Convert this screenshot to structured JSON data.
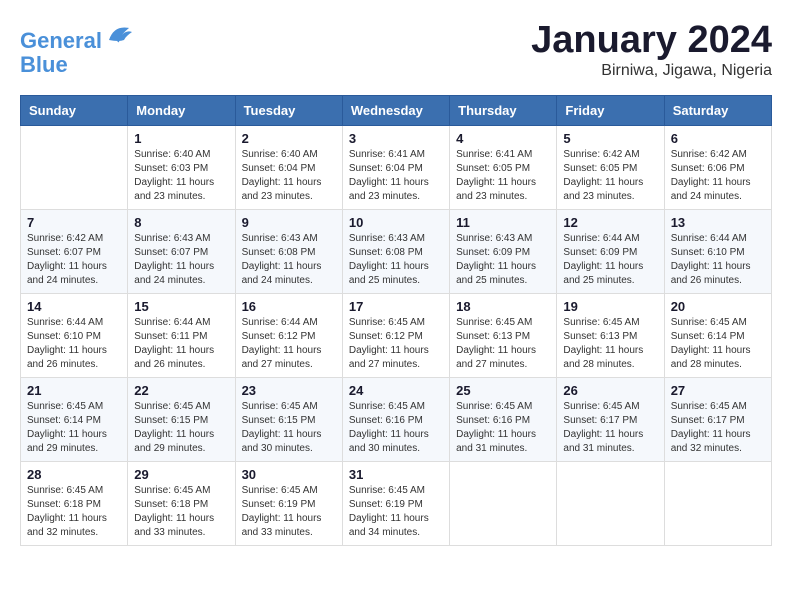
{
  "logo": {
    "line1": "General",
    "line2": "Blue"
  },
  "title": "January 2024",
  "subtitle": "Birniwa, Jigawa, Nigeria",
  "days_of_week": [
    "Sunday",
    "Monday",
    "Tuesday",
    "Wednesday",
    "Thursday",
    "Friday",
    "Saturday"
  ],
  "weeks": [
    [
      {
        "day": "",
        "info": ""
      },
      {
        "day": "1",
        "info": "Sunrise: 6:40 AM\nSunset: 6:03 PM\nDaylight: 11 hours\nand 23 minutes."
      },
      {
        "day": "2",
        "info": "Sunrise: 6:40 AM\nSunset: 6:04 PM\nDaylight: 11 hours\nand 23 minutes."
      },
      {
        "day": "3",
        "info": "Sunrise: 6:41 AM\nSunset: 6:04 PM\nDaylight: 11 hours\nand 23 minutes."
      },
      {
        "day": "4",
        "info": "Sunrise: 6:41 AM\nSunset: 6:05 PM\nDaylight: 11 hours\nand 23 minutes."
      },
      {
        "day": "5",
        "info": "Sunrise: 6:42 AM\nSunset: 6:05 PM\nDaylight: 11 hours\nand 23 minutes."
      },
      {
        "day": "6",
        "info": "Sunrise: 6:42 AM\nSunset: 6:06 PM\nDaylight: 11 hours\nand 24 minutes."
      }
    ],
    [
      {
        "day": "7",
        "info": "Sunrise: 6:42 AM\nSunset: 6:07 PM\nDaylight: 11 hours\nand 24 minutes."
      },
      {
        "day": "8",
        "info": "Sunrise: 6:43 AM\nSunset: 6:07 PM\nDaylight: 11 hours\nand 24 minutes."
      },
      {
        "day": "9",
        "info": "Sunrise: 6:43 AM\nSunset: 6:08 PM\nDaylight: 11 hours\nand 24 minutes."
      },
      {
        "day": "10",
        "info": "Sunrise: 6:43 AM\nSunset: 6:08 PM\nDaylight: 11 hours\nand 25 minutes."
      },
      {
        "day": "11",
        "info": "Sunrise: 6:43 AM\nSunset: 6:09 PM\nDaylight: 11 hours\nand 25 minutes."
      },
      {
        "day": "12",
        "info": "Sunrise: 6:44 AM\nSunset: 6:09 PM\nDaylight: 11 hours\nand 25 minutes."
      },
      {
        "day": "13",
        "info": "Sunrise: 6:44 AM\nSunset: 6:10 PM\nDaylight: 11 hours\nand 26 minutes."
      }
    ],
    [
      {
        "day": "14",
        "info": "Sunrise: 6:44 AM\nSunset: 6:10 PM\nDaylight: 11 hours\nand 26 minutes."
      },
      {
        "day": "15",
        "info": "Sunrise: 6:44 AM\nSunset: 6:11 PM\nDaylight: 11 hours\nand 26 minutes."
      },
      {
        "day": "16",
        "info": "Sunrise: 6:44 AM\nSunset: 6:12 PM\nDaylight: 11 hours\nand 27 minutes."
      },
      {
        "day": "17",
        "info": "Sunrise: 6:45 AM\nSunset: 6:12 PM\nDaylight: 11 hours\nand 27 minutes."
      },
      {
        "day": "18",
        "info": "Sunrise: 6:45 AM\nSunset: 6:13 PM\nDaylight: 11 hours\nand 27 minutes."
      },
      {
        "day": "19",
        "info": "Sunrise: 6:45 AM\nSunset: 6:13 PM\nDaylight: 11 hours\nand 28 minutes."
      },
      {
        "day": "20",
        "info": "Sunrise: 6:45 AM\nSunset: 6:14 PM\nDaylight: 11 hours\nand 28 minutes."
      }
    ],
    [
      {
        "day": "21",
        "info": "Sunrise: 6:45 AM\nSunset: 6:14 PM\nDaylight: 11 hours\nand 29 minutes."
      },
      {
        "day": "22",
        "info": "Sunrise: 6:45 AM\nSunset: 6:15 PM\nDaylight: 11 hours\nand 29 minutes."
      },
      {
        "day": "23",
        "info": "Sunrise: 6:45 AM\nSunset: 6:15 PM\nDaylight: 11 hours\nand 30 minutes."
      },
      {
        "day": "24",
        "info": "Sunrise: 6:45 AM\nSunset: 6:16 PM\nDaylight: 11 hours\nand 30 minutes."
      },
      {
        "day": "25",
        "info": "Sunrise: 6:45 AM\nSunset: 6:16 PM\nDaylight: 11 hours\nand 31 minutes."
      },
      {
        "day": "26",
        "info": "Sunrise: 6:45 AM\nSunset: 6:17 PM\nDaylight: 11 hours\nand 31 minutes."
      },
      {
        "day": "27",
        "info": "Sunrise: 6:45 AM\nSunset: 6:17 PM\nDaylight: 11 hours\nand 32 minutes."
      }
    ],
    [
      {
        "day": "28",
        "info": "Sunrise: 6:45 AM\nSunset: 6:18 PM\nDaylight: 11 hours\nand 32 minutes."
      },
      {
        "day": "29",
        "info": "Sunrise: 6:45 AM\nSunset: 6:18 PM\nDaylight: 11 hours\nand 33 minutes."
      },
      {
        "day": "30",
        "info": "Sunrise: 6:45 AM\nSunset: 6:19 PM\nDaylight: 11 hours\nand 33 minutes."
      },
      {
        "day": "31",
        "info": "Sunrise: 6:45 AM\nSunset: 6:19 PM\nDaylight: 11 hours\nand 34 minutes."
      },
      {
        "day": "",
        "info": ""
      },
      {
        "day": "",
        "info": ""
      },
      {
        "day": "",
        "info": ""
      }
    ]
  ]
}
